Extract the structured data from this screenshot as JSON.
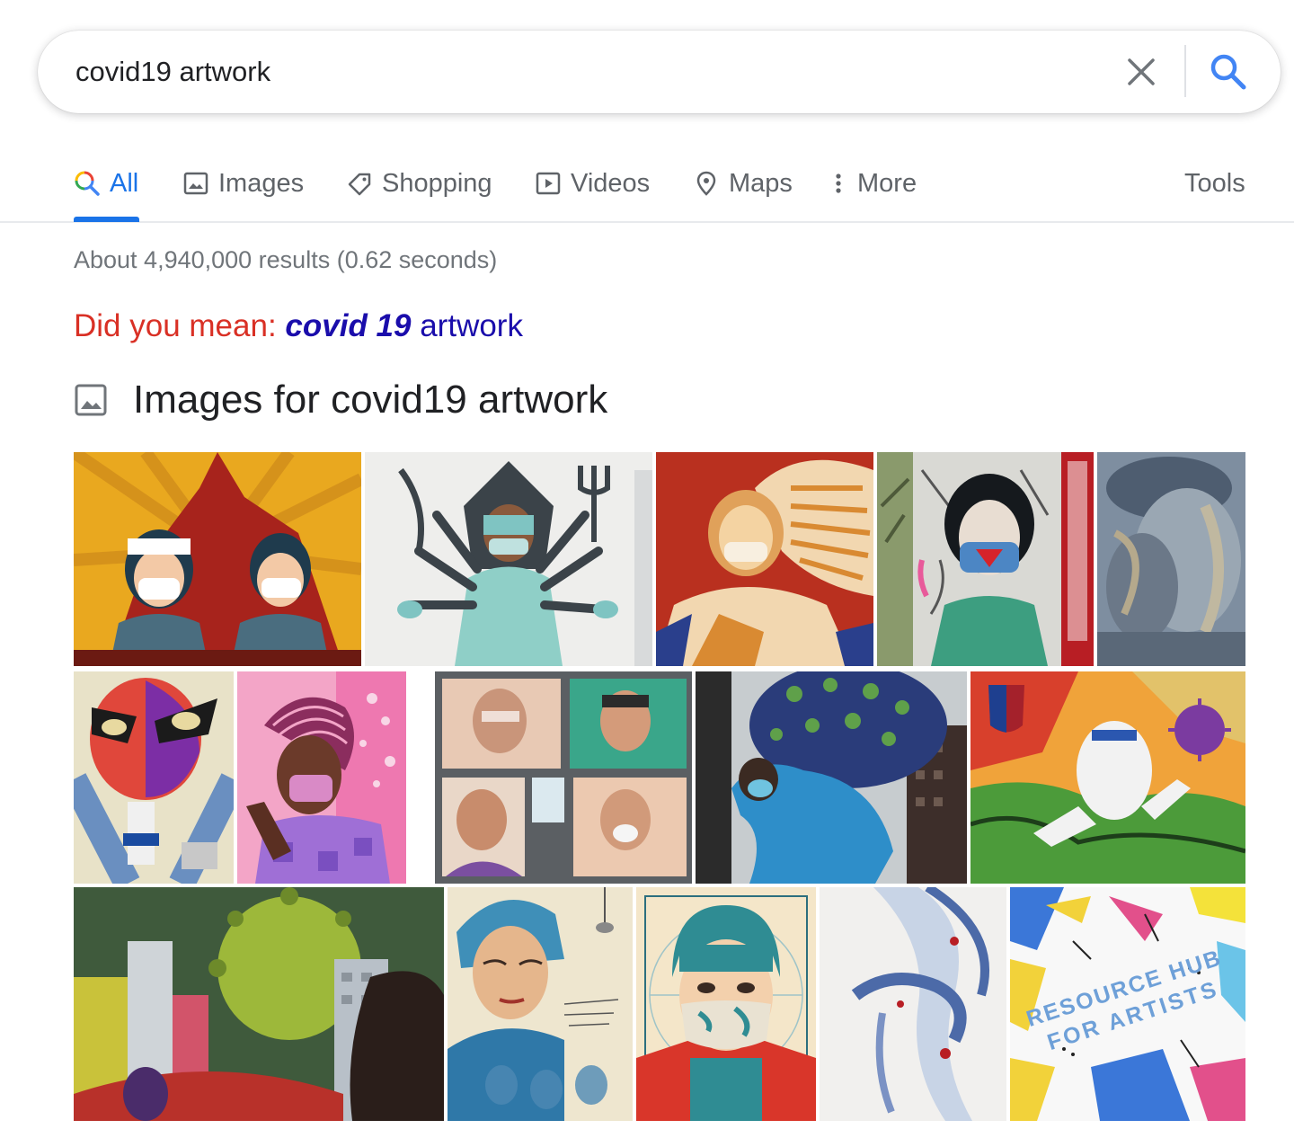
{
  "search": {
    "query": "covid19 artwork"
  },
  "tabs": [
    {
      "label": "All",
      "icon": "search-icon"
    },
    {
      "label": "Images",
      "icon": "image-icon"
    },
    {
      "label": "Shopping",
      "icon": "tag-icon"
    },
    {
      "label": "Videos",
      "icon": "play-icon"
    },
    {
      "label": "Maps",
      "icon": "map-pin-icon"
    },
    {
      "label": "More",
      "icon": "more-vertical-icon"
    }
  ],
  "tools_label": "Tools",
  "results_stats": "About 4,940,000 results (0.62 seconds)",
  "did_you_mean": {
    "label": "Did you mean:",
    "suggestion_bold": "covid 19",
    "suggestion_rest": "artwork"
  },
  "images_section": {
    "title": "Images for covid19 artwork"
  },
  "image_texts": {
    "resource_hub_line1": "RESOURCE HUB",
    "resource_hub_line2": "FOR ARTISTS"
  },
  "colors": {
    "accent": "#1a73e8",
    "did_you_mean_label": "#d93025",
    "suggestion_link": "#1a0dab",
    "muted_text": "#70757a"
  }
}
